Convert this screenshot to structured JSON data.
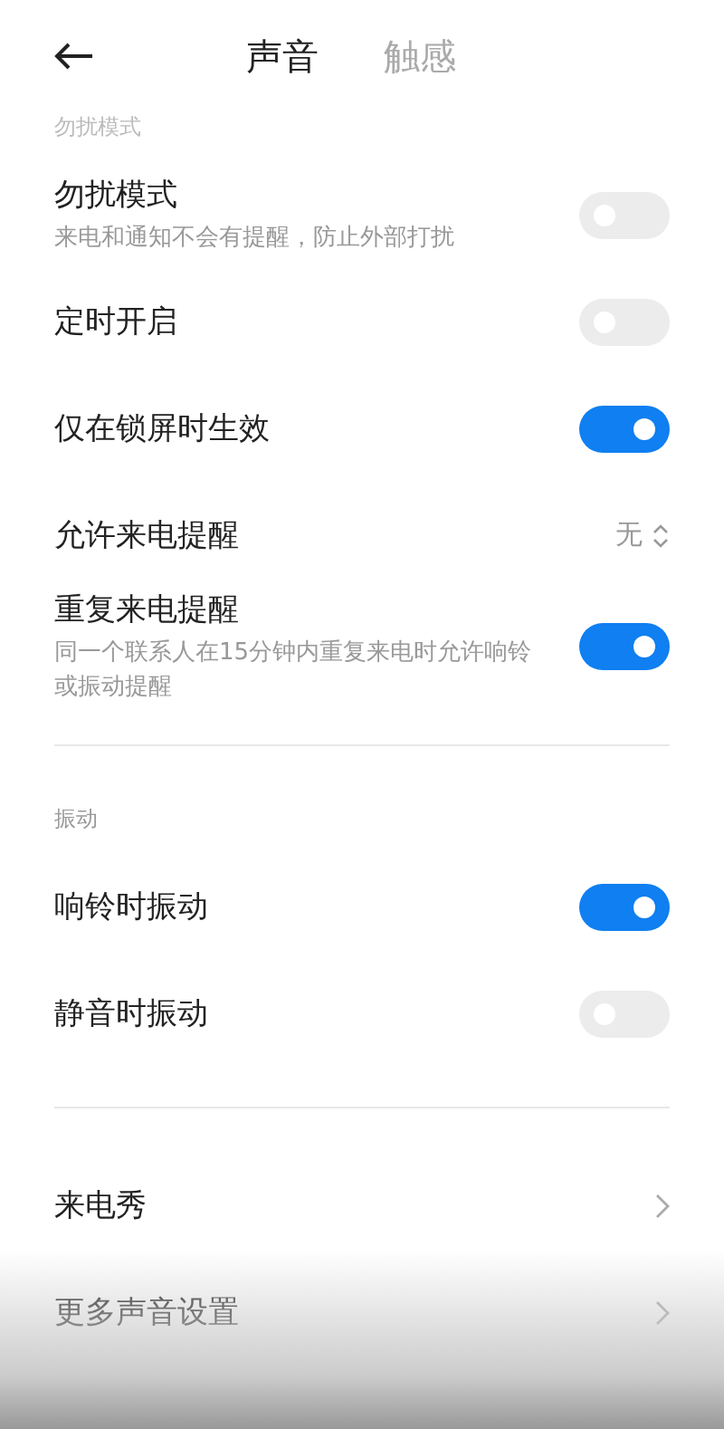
{
  "header": {
    "tabs": [
      {
        "label": "声音",
        "selected": true
      },
      {
        "label": "触感",
        "selected": false
      }
    ]
  },
  "sections": [
    {
      "title": "勿扰模式",
      "items": [
        {
          "kind": "toggle",
          "label": "勿扰模式",
          "description": "来电和通知不会有提醒，防止外部打扰",
          "on": false
        },
        {
          "kind": "toggle",
          "label": "定时开启",
          "on": false
        },
        {
          "kind": "toggle",
          "label": "仅在锁屏时生效",
          "on": true
        },
        {
          "kind": "select",
          "label": "允许来电提醒",
          "value": "无"
        },
        {
          "kind": "toggle",
          "label": "重复来电提醒",
          "description": "同一个联系人在15分钟内重复来电时允许响铃或振动提醒",
          "on": true
        }
      ]
    },
    {
      "title": "振动",
      "items": [
        {
          "kind": "toggle",
          "label": "响铃时振动",
          "on": true
        },
        {
          "kind": "toggle",
          "label": "静音时振动",
          "on": false
        }
      ]
    },
    {
      "items": [
        {
          "kind": "link",
          "label": "来电秀"
        },
        {
          "kind": "link",
          "label": "更多声音设置"
        }
      ]
    }
  ]
}
